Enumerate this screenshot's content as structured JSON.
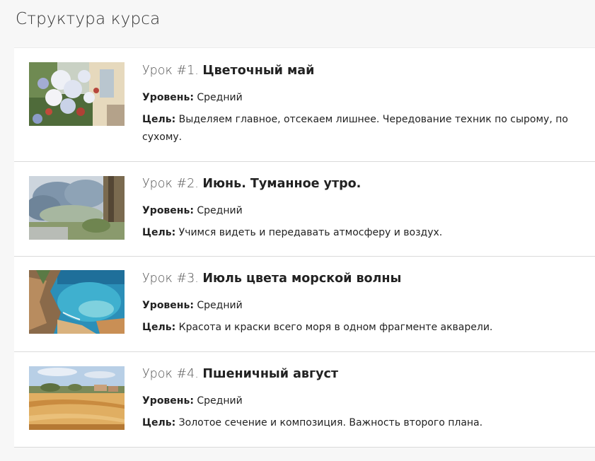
{
  "page": {
    "title": "Структура курса"
  },
  "labels": {
    "level": "Уровень:",
    "goal": "Цель:"
  },
  "lessons": [
    {
      "number": "Урок #1.",
      "name": "Цветочный май",
      "level": "Средний",
      "goal": "Выделяем главное, отсекаем лишнее. Чередование техник по сырому, по сухому."
    },
    {
      "number": "Урок #2.",
      "name": "Июнь. Туманное утро.",
      "level": "Средний",
      "goal": "Учимся видеть и передавать атмосферу и воздух."
    },
    {
      "number": "Урок #3.",
      "name": "Июль цвета морской волны",
      "level": "Средний",
      "goal": "Красота и краски всего моря в одном фрагменте акварели."
    },
    {
      "number": "Урок #4.",
      "name": "Пшеничный август",
      "level": "Средний",
      "goal": "Золотое сечение и композиция. Важность второго плана."
    }
  ]
}
